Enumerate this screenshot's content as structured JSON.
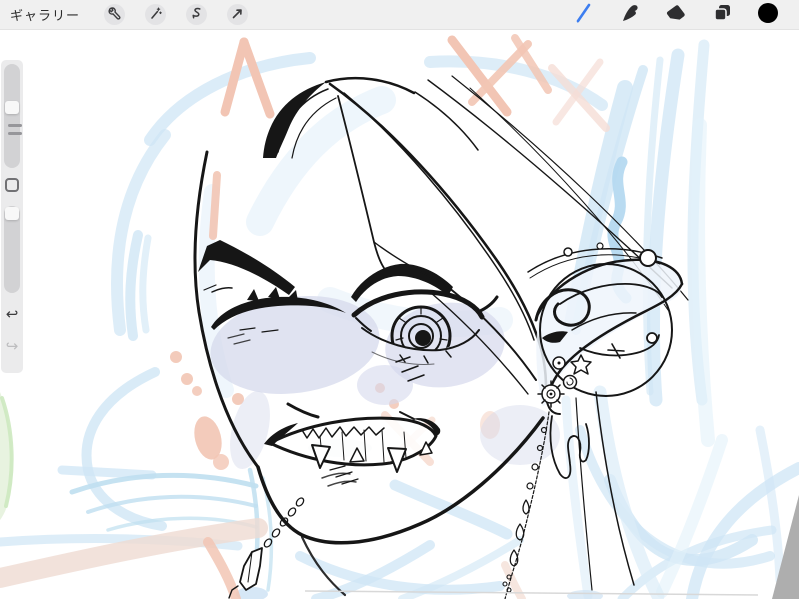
{
  "topbar": {
    "gallery_label": "ギャラリー",
    "left_tools": [
      {
        "name": "actions",
        "icon": "wrench-icon"
      },
      {
        "name": "adjustments",
        "icon": "magic-wand-icon"
      },
      {
        "name": "selection",
        "icon": "selection-s-icon"
      },
      {
        "name": "transform",
        "icon": "transform-arrow-icon"
      }
    ],
    "right_tools": [
      {
        "name": "paint",
        "icon": "brush-icon",
        "active": true
      },
      {
        "name": "smudge",
        "icon": "smudge-icon",
        "active": false
      },
      {
        "name": "erase",
        "icon": "eraser-icon",
        "active": false
      },
      {
        "name": "layers",
        "icon": "layers-icon",
        "active": false
      },
      {
        "name": "color",
        "icon": "color-swatch-circle",
        "current_color": "#000000"
      }
    ],
    "colors": {
      "bar_bg": "#efeff0",
      "button_bg": "#e3e3e5",
      "icon_dark": "#333336",
      "active_blue": "#3d7ef0"
    }
  },
  "sidebar": {
    "size_slider": {
      "name": "brush-size",
      "handle_position": "upper-third"
    },
    "opacity_slider": {
      "name": "brush-opacity",
      "handle_position": "top"
    },
    "modify_button": {
      "shape": "rounded-square"
    },
    "undo_glyph": "↩",
    "redo_glyph": "↪",
    "redo_disabled": true
  },
  "canvas": {
    "content": "winking grinning face line art with elf ear jewelry, rough sketch underlayers",
    "colors": {
      "ink": "#161616",
      "sketch_blue": "#cfe6f5",
      "sketch_blue_strong": "#b5d9f0",
      "sketch_salmon": "#f2c5b4",
      "sketch_salmon_pale": "#efdbd2",
      "shade_lavender": "#d5d9ec",
      "sketch_green": "#cde9c0",
      "workspace_gray": "#aeaeae"
    }
  }
}
